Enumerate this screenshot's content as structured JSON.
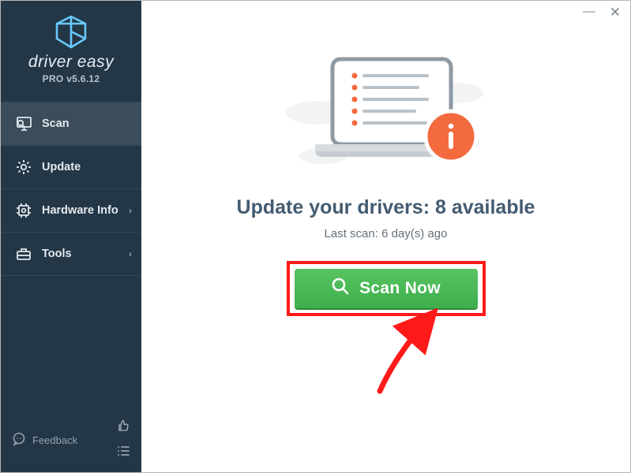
{
  "brand": {
    "name": "driver easy",
    "version": "PRO v5.6.12"
  },
  "nav": {
    "scan": {
      "label": "Scan"
    },
    "update": {
      "label": "Update"
    },
    "hw": {
      "label": "Hardware Info"
    },
    "tools": {
      "label": "Tools"
    }
  },
  "footer": {
    "feedback": "Feedback"
  },
  "main": {
    "headline": "Update your drivers: 8 available",
    "subline": "Last scan: 6 day(s) ago",
    "scan_label": "Scan Now"
  }
}
